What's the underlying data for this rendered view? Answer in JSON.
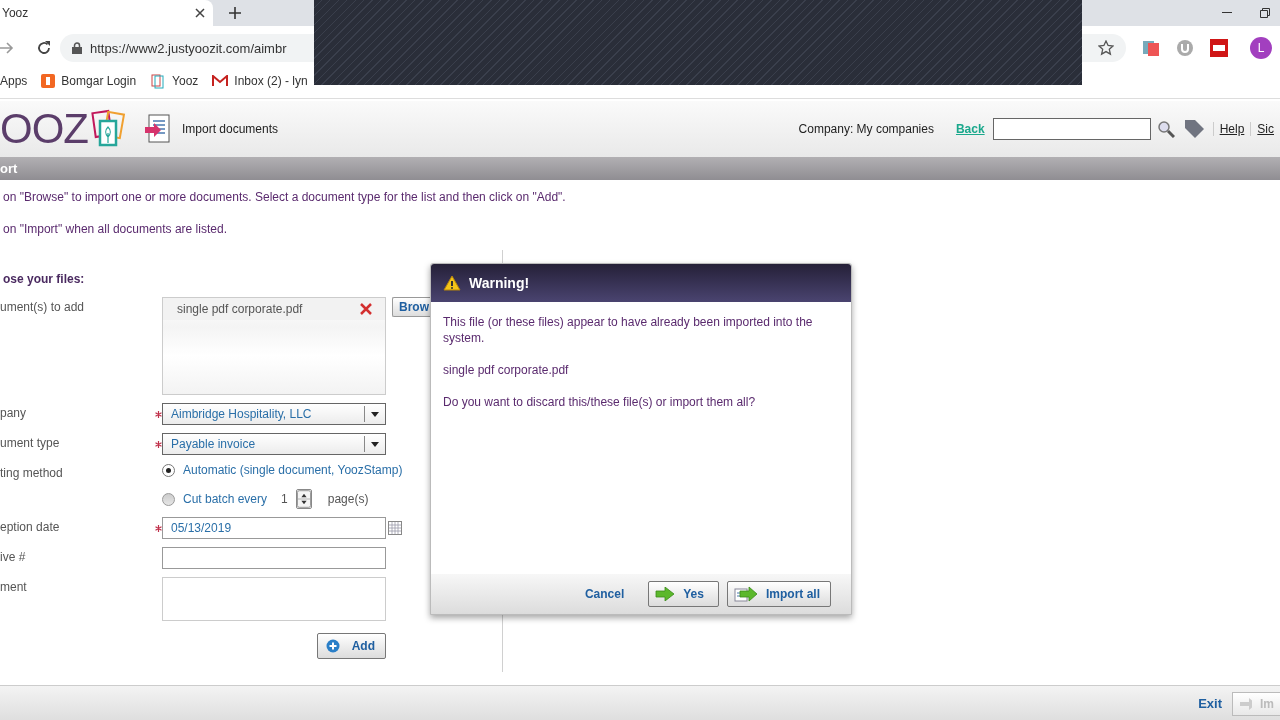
{
  "browser": {
    "tab_title": "Yooz",
    "url": "https://www2.justyoozit.com/aimbr",
    "bookmarks": [
      {
        "label": "Apps",
        "kind": "apps"
      },
      {
        "label": "Bomgar Login",
        "kind": "bomgar"
      },
      {
        "label": "Yooz",
        "kind": "yooz"
      },
      {
        "label": "Inbox (2) - lyn",
        "kind": "mail"
      }
    ],
    "profile_initial": "L"
  },
  "header": {
    "logo": "OOZ",
    "page_title": "Import documents",
    "company": "Company: My companies",
    "back_link": "Back",
    "links": [
      "Help",
      "Sic"
    ]
  },
  "section_title": "ort",
  "instructions": [
    "on \"Browse\" to import one or more documents. Select a document type for the list and then click on \"Add\".",
    "on \"Import\" when all documents are listed."
  ],
  "files_heading": "ose your files:",
  "form": {
    "documents_label": "ument(s) to add",
    "files": [
      "single pdf corporate.pdf"
    ],
    "browse_button": "Brow",
    "company_label": "pany",
    "company_value": "Aimbridge Hospitality, LLC",
    "company_required": true,
    "type_label": "ument type",
    "type_value": "Payable invoice",
    "type_required": true,
    "method_label": "ting method",
    "methods": [
      {
        "label": "Automatic (single document, YoozStamp)",
        "selected": true
      },
      {
        "label": "Cut batch every",
        "selected": false,
        "count": "1",
        "unit": "page(s)"
      }
    ],
    "date_label": "eption date",
    "date_value": "05/13/2019",
    "date_required": true,
    "archive_label": "ive #",
    "comment_label": "ment",
    "add_button": "Add"
  },
  "dialog": {
    "title": "Warning!",
    "message": "This file (or these files) appear to have already been imported into the system.",
    "file": "single pdf corporate.pdf",
    "question": "Do you want to discard this/these file(s) or import them all?",
    "buttons": [
      {
        "label": "Cancel",
        "kind": "link"
      },
      {
        "label": "Yes",
        "kind": "yes"
      },
      {
        "label": "Import all",
        "kind": "import"
      }
    ]
  },
  "footer": {
    "exit": "Exit",
    "import_button": "Im",
    "import_disabled": true
  }
}
